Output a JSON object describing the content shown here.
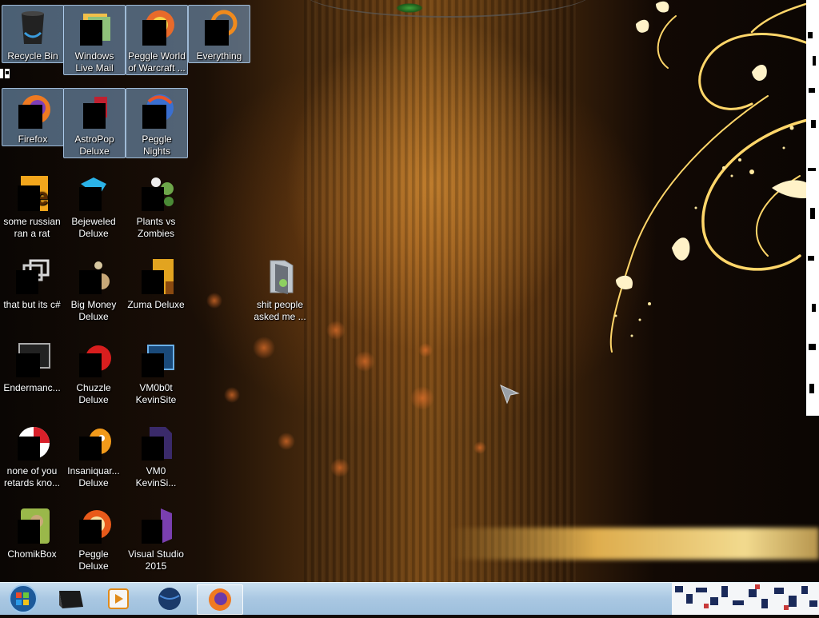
{
  "desktop": {
    "icons": [
      {
        "label": "Recycle Bin",
        "icon": "recycle-bin-icon"
      },
      {
        "label": "Windows Live Mail",
        "icon": "windows-live-mail-icon"
      },
      {
        "label": "Peggle World of Warcraft ...",
        "icon": "peggle-icon"
      },
      {
        "label": "Everything",
        "icon": "everything-search-icon"
      },
      {
        "label": "Firefox",
        "icon": "firefox-icon"
      },
      {
        "label": "AstroPop Deluxe",
        "icon": "astropop-icon"
      },
      {
        "label": "Peggle Nights Deluxe",
        "icon": "peggle-nights-icon"
      },
      {
        "label": "some russian ran a rat",
        "icon": "folder-e-icon"
      },
      {
        "label": "Bejeweled Deluxe",
        "icon": "bejeweled-icon"
      },
      {
        "label": "Plants vs Zombies",
        "icon": "plants-vs-zombies-icon"
      },
      {
        "label": "that but its c#",
        "icon": "window-stack-icon"
      },
      {
        "label": "Big Money Deluxe",
        "icon": "big-money-icon"
      },
      {
        "label": "Zuma Deluxe",
        "icon": "zuma-icon"
      },
      {
        "label": "Endermanc...",
        "icon": "terminal-icon"
      },
      {
        "label": "Chuzzle Deluxe",
        "icon": "chuzzle-icon"
      },
      {
        "label": "VM0b0t KevinSite",
        "icon": "vm-icon"
      },
      {
        "label": "none of you retards kno...",
        "icon": "red-ball-icon"
      },
      {
        "label": "Insaniquar... Deluxe",
        "icon": "insaniquarium-icon"
      },
      {
        "label": "VM0 KevinSi...",
        "icon": "document-icon"
      },
      {
        "label": "ChomikBox",
        "icon": "chomikbox-icon"
      },
      {
        "label": "Peggle Deluxe",
        "icon": "peggle-deluxe-icon"
      },
      {
        "label": "Visual Studio 2015",
        "icon": "visual-studio-icon"
      },
      {
        "label": "shit people asked me ...",
        "icon": "folder-icon"
      }
    ]
  },
  "taskbar": {
    "start": "start-orb-icon",
    "pinned": [
      "terminal-app-icon",
      "media-player-icon",
      "globe-icon",
      "firefox-icon"
    ]
  },
  "colors": {
    "taskbar": "#a9c7e2",
    "selection": "#82aad2",
    "wallpaper_glow": "#f0b040"
  }
}
